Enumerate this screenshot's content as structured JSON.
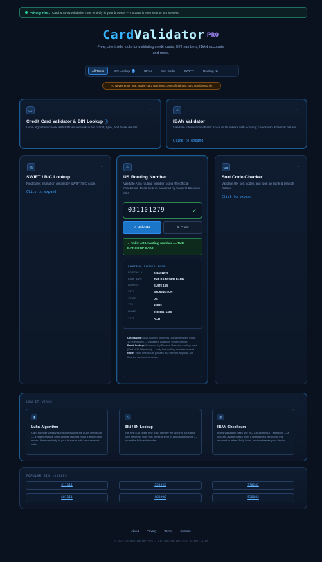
{
  "privacy": {
    "bold": "Privacy First:",
    "text": "Card & IBAN validation runs entirely in your browser — no data is ever sent to our servers."
  },
  "brand": {
    "part1": "Card",
    "part2": "Validator",
    "suffix": "PRO",
    "subtitle": "Free, client-side tools for validating credit cards, BIN numbers, IBAN accounts, and more."
  },
  "tabs": [
    {
      "label": "All Tools",
      "active": true
    },
    {
      "label": "BIN Lookup",
      "badge": "i"
    },
    {
      "label": "IBAN"
    },
    {
      "label": "Sort Code"
    },
    {
      "label": "SWIFT"
    },
    {
      "label": "Routing №"
    }
  ],
  "warning": "Never enter real, active card numbers. Use official test card numbers only.",
  "cards": {
    "credit": {
      "title": "Credit Card Validator & BIN Lookup",
      "desc": "Luhn algorithm check with BIN issuer lookup for brand, type, and bank details."
    },
    "iban": {
      "title": "IBAN Validator",
      "desc": "Validate International Bank Account Numbers with country, checksum & format details.",
      "expand": "Click to expand"
    },
    "swift": {
      "title": "SWIFT / BIC Lookup",
      "desc": "Find bank institution details by SWIFT/BIC code.",
      "expand": "Click to expand"
    },
    "routing": {
      "title": "US Routing Number",
      "desc": "Validate ABA routing number using the official checksum. Bank lookup powered by Federal Reserve data.",
      "input_value": "031101279",
      "validate_label": "Validate",
      "clear_label": "Clear",
      "success": "Valid ABA routing number — THE BANCORP BANK",
      "info_head": "ROUTING NUMBER INFO",
      "info_rows": [
        {
          "k": "ROUTING #",
          "v": "031101279"
        },
        {
          "k": "BANK NAME",
          "v": "THE BANCORP BANK"
        },
        {
          "k": "ADDRESS",
          "v": "SUITE 105"
        },
        {
          "k": "CITY",
          "v": "WILMINGTON"
        },
        {
          "k": "STATE",
          "v": "DE"
        },
        {
          "k": "ZIP",
          "v": "19809"
        },
        {
          "k": "PHONE",
          "v": "000-866-5489"
        },
        {
          "k": "TYPE",
          "v": "ACH"
        }
      ],
      "note_checksum_label": "Checksum:",
      "note_checksum": "ABA routing numbers use a weighted mod-10 checksum — validated locally in your browser.",
      "note_lookup_label": "Bank lookup:",
      "note_lookup": "Powered by Federal Reserve routing data (FedACH Directory) — only the routing number is sent.",
      "note_note_label": "Note:",
      "note_note": "Valid checksum passes but without any use, or that the account is active."
    },
    "sort": {
      "title": "Sort Code Checker",
      "desc": "Validate UK sort codes and look up bank & branch details.",
      "expand": "Click to expand",
      "badge": "GB"
    }
  },
  "how": {
    "head": "HOW IT WORKS",
    "items": [
      {
        "title": "Luhn Algorithm",
        "desc": "Card number validity is checked using the Luhn checksum — a mathematical formula that catches most transcription errors. It runs entirely in your browser with zero network calls."
      },
      {
        "title": "BIN / IIN Lookup",
        "desc": "The first 6–8 digits (the BIN) identify the issuing bank and card network. Only this prefix is sent to a lookup service — never the full card number."
      },
      {
        "title": "IBAN Checksum",
        "desc": "IBAN validation uses the ISO 13616 mod-97 standard — a country-aware check over a rearranged version of the account number. Fully local, no data leaves your device."
      }
    ]
  },
  "popular": {
    "head": "POPULAR BIN LOOKUPS",
    "bins": [
      "411111",
      "555555",
      "378282",
      "601111",
      "400000",
      "520082"
    ]
  },
  "footer": {
    "links": [
      "About",
      "Privacy",
      "Terms",
      "Contact"
    ],
    "copyright": "© 2025 CardValidator Pro — All validation runs client-side"
  }
}
